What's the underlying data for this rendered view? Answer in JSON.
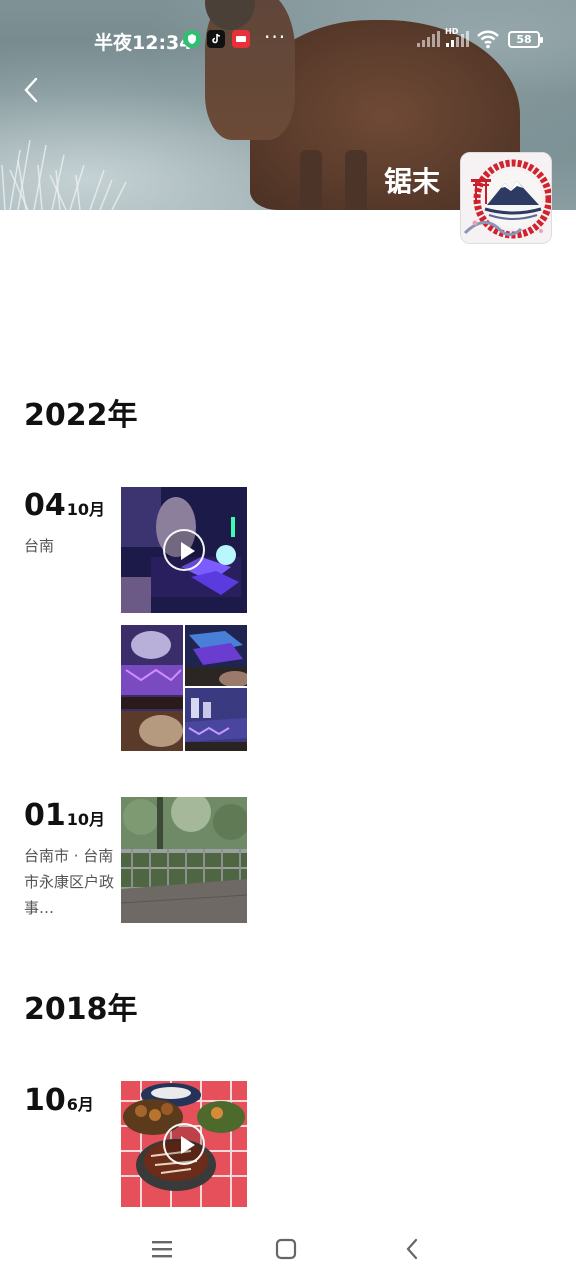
{
  "status_bar": {
    "time": "半夜12:34",
    "more_indicator": "···",
    "network_label": "HD",
    "battery_level": "58",
    "app_icons": [
      "shield-icon",
      "tiktok-icon",
      "red-app-icon"
    ]
  },
  "header": {
    "user_name": "锯末"
  },
  "timeline": {
    "years": [
      {
        "label": "2022年",
        "entries": [
          {
            "day": "04",
            "month": "10月",
            "location": "台南",
            "media": [
              "video",
              "photo",
              "photo",
              "photo"
            ]
          },
          {
            "day": "01",
            "month": "10月",
            "location": "台南市 · 台南市永康区户政事…",
            "media": [
              "photo"
            ]
          }
        ]
      },
      {
        "label": "2018年",
        "entries": [
          {
            "day": "10",
            "month": "6月",
            "location": "",
            "media": [
              "video"
            ]
          }
        ]
      }
    ]
  },
  "nav_bar": {
    "items": [
      "menu-icon",
      "home-icon",
      "back-icon"
    ]
  },
  "colors": {
    "text_primary": "#111111",
    "text_secondary": "#555555",
    "background": "#ffffff"
  }
}
